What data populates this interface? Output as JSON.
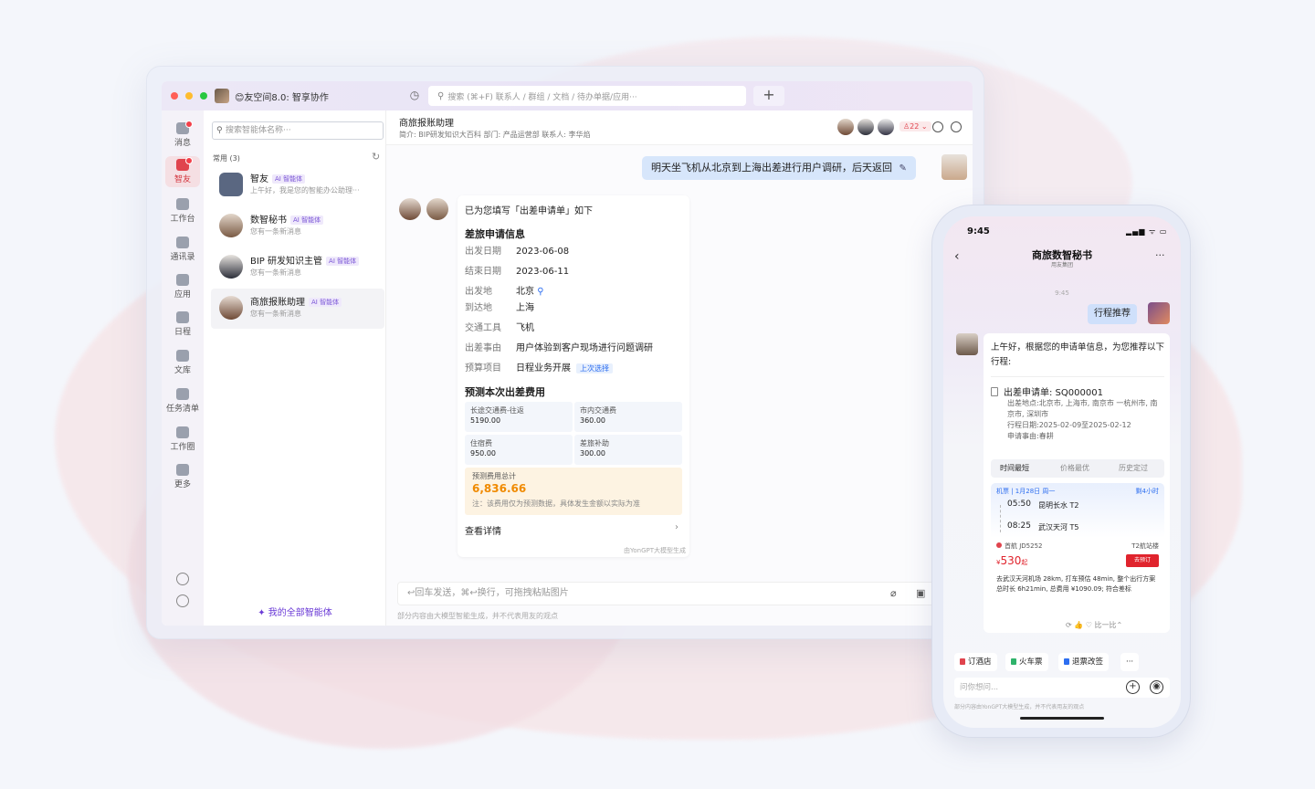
{
  "titlebar": {
    "app_title": "😊友空间8.0: 智享协作",
    "search_placeholder": "搜索 (⌘+F) 联系人 / 群组 / 文档 / 待办单据/应用···",
    "add_label": "+"
  },
  "rail": {
    "items": [
      {
        "label": "消息",
        "icon": "message-icon"
      },
      {
        "label": "智友",
        "icon": "ai-bot-icon",
        "active": true
      },
      {
        "label": "工作台",
        "icon": "workbench-icon"
      },
      {
        "label": "通讯录",
        "icon": "contacts-icon"
      },
      {
        "label": "应用",
        "icon": "apps-icon"
      },
      {
        "label": "日程",
        "icon": "calendar-icon"
      },
      {
        "label": "文库",
        "icon": "library-icon"
      },
      {
        "label": "任务清单",
        "icon": "task-icon"
      },
      {
        "label": "工作圈",
        "icon": "circle-icon"
      },
      {
        "label": "更多",
        "icon": "more-icon"
      }
    ]
  },
  "agents": {
    "search_placeholder": "搜索智能体名称···",
    "group_label": "常用 (3)",
    "tag": "AI 智能体",
    "list": [
      {
        "name": "智友",
        "sub": "上午好，我是您的智能办公助理···"
      },
      {
        "name": "数智秘书",
        "sub": "您有一条新消息"
      },
      {
        "name": "BIP 研发知识主管",
        "sub": "您有一条新消息"
      },
      {
        "name": "商旅报账助理",
        "sub": "您有一条新消息"
      }
    ],
    "all_label": "✦ 我的全部智能体"
  },
  "chat": {
    "title": "商旅报账助理",
    "meta": "简介: BIP研发知识大百科    部门: 产品运营部    联系人: 李华焰",
    "member_count": "22",
    "user_message": "明天坐飞机从北京到上海出差进行用户调研，后天返回",
    "card": {
      "intro": "已为您填写「出差申请单」如下",
      "section1": "差旅申请信息",
      "fields": [
        {
          "k": "出发日期",
          "v": "2023-06-08"
        },
        {
          "k": "结束日期",
          "v": "2023-06-11"
        },
        {
          "k": "出发地",
          "v": "北京"
        },
        {
          "k": "到达地",
          "v": "上海"
        },
        {
          "k": "交通工具",
          "v": "飞机"
        },
        {
          "k": "出差事由",
          "v": "用户体验到客户现场进行问题调研"
        },
        {
          "k": "预算项目",
          "v": "日程业务开展"
        }
      ],
      "reselect": "上次选择",
      "section2": "预测本次出差费用",
      "costs": [
        {
          "label": "长途交通费-往返",
          "value": "5190.00"
        },
        {
          "label": "市内交通费",
          "value": "360.00"
        },
        {
          "label": "住宿费",
          "value": "950.00"
        },
        {
          "label": "差旅补助",
          "value": "300.00"
        }
      ],
      "total_label": "预测费用总计",
      "total_value": "6,836.66",
      "total_note": "注：该费用仅为预测数据，具体发生金额以实际为准",
      "view_detail": "查看详情",
      "footer": "由YonGPT大模型生成"
    },
    "input_placeholder": "↩回车发送，⌘↩换行，可拖拽粘贴图片",
    "disclaimer": "部分内容由大模型智能生成，并不代表用友的观点"
  },
  "phone": {
    "time": "9:45",
    "status": "▂▄▆ ᯤ ▭",
    "title": "商旅数智秘书",
    "subtitle": "用友集团",
    "stamp": "9:45",
    "user_message": "行程推荐",
    "greeting": "上午好，根据您的申请单信息，为您推荐以下行程:",
    "application": "出差申请单: SQ000001",
    "details": [
      "出差地点:北京市, 上海市, 南京市 一杭州市, 南京市, 深圳市",
      "行程日期:2025-02-09至2025-02-12",
      "申请事由:春耕"
    ],
    "tabs": [
      "时间最短",
      "价格最优",
      "历史定过"
    ],
    "flight": {
      "header": "机票 | 1月28日 周一",
      "duration": "剩4小时",
      "dep_time": "05:50",
      "dep_place": "昆明长水 T2",
      "arr_time": "08:25",
      "arr_place": "武汉天河 T5",
      "airline": "首航 JD5252",
      "terminal": "T2航站楼",
      "price": "530",
      "price_prefix": "¥",
      "price_suffix": "起",
      "book": "去预订",
      "note": "去武汉天河机场 28km, 打车预估 48min, 整个出行方案总时长 6h21min, 总费用 ¥1090.09; 符合差标"
    },
    "actions": "⟳  👍  ♡   比一比⌃",
    "chips": [
      "订酒店",
      "火车票",
      "退票改签",
      "···"
    ],
    "input_placeholder": "问你想问...",
    "disclaimer": "部分内容由YonGPT大模型生成，并不代表用友的观点"
  }
}
